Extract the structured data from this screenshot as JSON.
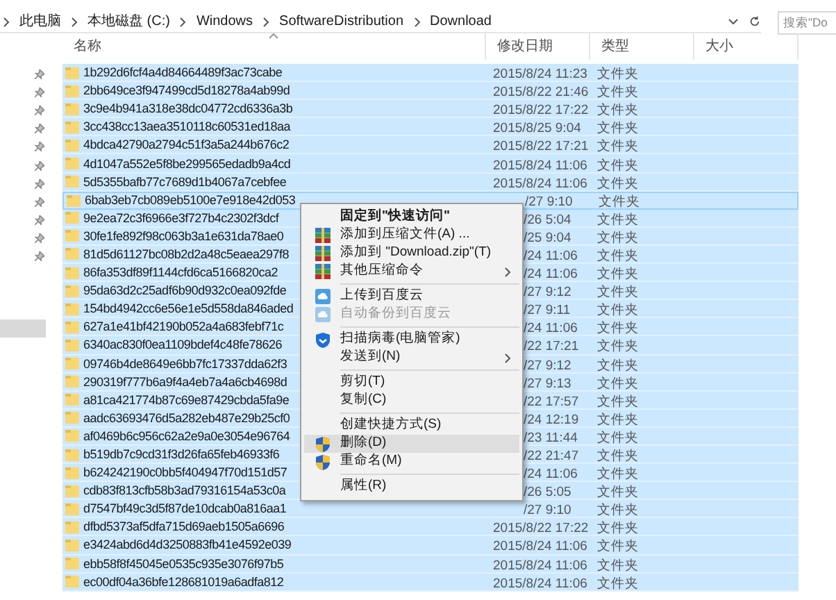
{
  "address_bar": {
    "crumbs": [
      "此电脑",
      "本地磁盘 (C:)",
      "Windows",
      "SoftwareDistribution",
      "Download"
    ]
  },
  "search": {
    "placeholder": "搜索\"Do"
  },
  "nav_items": [
    {
      "pinned": true,
      "selected": false
    },
    {
      "pinned": true,
      "selected": false
    },
    {
      "pinned": true,
      "selected": false
    },
    {
      "pinned": true,
      "selected": false
    },
    {
      "pinned": true,
      "selected": false
    },
    {
      "pinned": true,
      "selected": false
    },
    {
      "pinned": true,
      "selected": false
    },
    {
      "pinned": true,
      "selected": false
    },
    {
      "pinned": true,
      "selected": false
    },
    {
      "pinned": true,
      "selected": false
    },
    {
      "pinned": true,
      "selected": false
    },
    {
      "pinned": false,
      "selected": false
    },
    {
      "pinned": false,
      "selected": false
    },
    {
      "pinned": false,
      "selected": false
    },
    {
      "pinned": false,
      "selected": true
    }
  ],
  "columns": [
    {
      "label": "名称",
      "sorted": true
    },
    {
      "label": "修改日期",
      "sorted": false
    },
    {
      "label": "类型",
      "sorted": false
    },
    {
      "label": "大小",
      "sorted": false
    }
  ],
  "rows": [
    {
      "name": "1b292d6fcf4a4d84664489f3ac73cabe",
      "date": "2015/8/24 11:23",
      "type": "文件夹",
      "selected": true,
      "focused": false,
      "date_covered": false
    },
    {
      "name": "2bb649ce3f947499cd5d18278a4ab99d",
      "date": "2015/8/22 21:46",
      "type": "文件夹",
      "selected": true,
      "focused": false,
      "date_covered": false
    },
    {
      "name": "3c9e4b941a318e38dc04772cd6336a3b",
      "date": "2015/8/22 17:22",
      "type": "文件夹",
      "selected": true,
      "focused": false,
      "date_covered": false
    },
    {
      "name": "3cc438cc13aea3510118c60531ed18aa",
      "date": "2015/8/25 9:04",
      "type": "文件夹",
      "selected": true,
      "focused": false,
      "date_covered": false
    },
    {
      "name": "4bdca42790a2794c51f3a5a244b676c2",
      "date": "2015/8/22 17:21",
      "type": "文件夹",
      "selected": true,
      "focused": false,
      "date_covered": false
    },
    {
      "name": "4d1047a552e5f8be299565edadb9a4cd",
      "date": "2015/8/24 11:06",
      "type": "文件夹",
      "selected": true,
      "focused": false,
      "date_covered": false
    },
    {
      "name": "5d5355bafb77c7689d1b4067a7cebfee",
      "date": "2015/8/24 11:06",
      "type": "文件夹",
      "selected": true,
      "focused": false,
      "date_covered": false
    },
    {
      "name": "6bab3eb7cb089eb5100e7e918e42d053",
      "date": "/27 9:10",
      "type": "文件夹",
      "selected": true,
      "focused": true,
      "date_covered": true
    },
    {
      "name": "9e2ea72c3f6966e3f727b4c2302f3dcf",
      "date": "/26 5:04",
      "type": "文件夹",
      "selected": true,
      "focused": false,
      "date_covered": true
    },
    {
      "name": "30fe1fe892f98c063b3a1e631da78ae0",
      "date": "/25 9:04",
      "type": "文件夹",
      "selected": true,
      "focused": false,
      "date_covered": true
    },
    {
      "name": "81d5d61127bc08b2d2a48c5eaea297f8",
      "date": "/24 11:06",
      "type": "文件夹",
      "selected": true,
      "focused": false,
      "date_covered": true
    },
    {
      "name": "86fa353df89f1144cfd6ca5166820ca2",
      "date": "/24 11:06",
      "type": "文件夹",
      "selected": true,
      "focused": false,
      "date_covered": true
    },
    {
      "name": "95da63d2c25adf6b90d932c0ea092fde",
      "date": "/27 9:12",
      "type": "文件夹",
      "selected": true,
      "focused": false,
      "date_covered": true
    },
    {
      "name": "154bd4942cc6e56e1e5d558da846aded",
      "date": "/27 9:11",
      "type": "文件夹",
      "selected": true,
      "focused": false,
      "date_covered": true
    },
    {
      "name": "627a1e41bf42190b052a4a683febf71c",
      "date": "/24 11:06",
      "type": "文件夹",
      "selected": true,
      "focused": false,
      "date_covered": true
    },
    {
      "name": "6340ac830f0ea1109bdef4c48fe78626",
      "date": "/22 17:21",
      "type": "文件夹",
      "selected": true,
      "focused": false,
      "date_covered": true
    },
    {
      "name": "09746b4de8649e6bb7fc17337dda62f3",
      "date": "/27 9:12",
      "type": "文件夹",
      "selected": true,
      "focused": false,
      "date_covered": true
    },
    {
      "name": "290319f777b6a9f4a4eb7a4a6cb4698d",
      "date": "/27 9:13",
      "type": "文件夹",
      "selected": true,
      "focused": false,
      "date_covered": true
    },
    {
      "name": "a81ca421774b87c69e87429cbda5fa9e",
      "date": "/22 17:57",
      "type": "文件夹",
      "selected": true,
      "focused": false,
      "date_covered": true
    },
    {
      "name": "aadc63693476d5a282eb487e29b25cf0",
      "date": "/24 12:19",
      "type": "文件夹",
      "selected": true,
      "focused": false,
      "date_covered": true
    },
    {
      "name": "af0469b6c956c62a2e9a0e3054e96764",
      "date": "/23 11:44",
      "type": "文件夹",
      "selected": true,
      "focused": false,
      "date_covered": true
    },
    {
      "name": "b519db7c9cd31f3d26fa65feb46933f6",
      "date": "/22 21:47",
      "type": "文件夹",
      "selected": true,
      "focused": false,
      "date_covered": true
    },
    {
      "name": "b624242190c0bb5f404947f70d151d57",
      "date": "/24 11:06",
      "type": "文件夹",
      "selected": true,
      "focused": false,
      "date_covered": true
    },
    {
      "name": "cdb83f813cfb58b3ad79316154a53c0a",
      "date": "/26 5:05",
      "type": "文件夹",
      "selected": true,
      "focused": false,
      "date_covered": true
    },
    {
      "name": "d7547bf49c3d5f87de10dcab0a816aa1",
      "date": "/27 9:10",
      "type": "文件夹",
      "selected": true,
      "focused": false,
      "date_covered": true
    },
    {
      "name": "dfbd5373af5dfa715d69aeb1505a6696",
      "date": "2015/8/22 17:22",
      "type": "文件夹",
      "selected": true,
      "focused": false,
      "date_covered": false
    },
    {
      "name": "e3424abd6d4d3250883fb41e4592e039",
      "date": "2015/8/24 11:06",
      "type": "文件夹",
      "selected": true,
      "focused": false,
      "date_covered": false
    },
    {
      "name": "ebb58f8f45045e0535c935e3076f97b5",
      "date": "2015/8/24 11:06",
      "type": "文件夹",
      "selected": true,
      "focused": false,
      "date_covered": false
    },
    {
      "name": "ec00df04a36bfe128681019a6adfa812",
      "date": "2015/8/24 11:06",
      "type": "文件夹",
      "selected": true,
      "focused": false,
      "date_covered": false
    }
  ],
  "context_menu": [
    {
      "kind": "item",
      "label": "固定到\"快速访问\"",
      "bold": true,
      "disabled": false,
      "highlighted": false,
      "submenu": false
    },
    {
      "kind": "archive",
      "label": "添加到压缩文件(A) ...",
      "bold": false,
      "disabled": false,
      "highlighted": false,
      "submenu": false
    },
    {
      "kind": "archive",
      "label": "添加到 \"Download.zip\"(T)",
      "bold": false,
      "disabled": false,
      "highlighted": false,
      "submenu": false
    },
    {
      "kind": "archive",
      "label": "其他压缩命令",
      "bold": false,
      "disabled": false,
      "highlighted": false,
      "submenu": true
    },
    {
      "kind": "separator"
    },
    {
      "kind": "cloud",
      "label": "上传到百度云",
      "bold": false,
      "disabled": false,
      "highlighted": false,
      "submenu": false
    },
    {
      "kind": "cloud",
      "label": "自动备份到百度云",
      "bold": false,
      "disabled": true,
      "highlighted": false,
      "submenu": false
    },
    {
      "kind": "separator"
    },
    {
      "kind": "scan",
      "label": "扫描病毒(电脑管家)",
      "bold": false,
      "disabled": false,
      "highlighted": false,
      "submenu": false
    },
    {
      "kind": "item",
      "label": "发送到(N)",
      "bold": false,
      "disabled": false,
      "highlighted": false,
      "submenu": true
    },
    {
      "kind": "separator"
    },
    {
      "kind": "item",
      "label": "剪切(T)",
      "bold": false,
      "disabled": false,
      "highlighted": false,
      "submenu": false
    },
    {
      "kind": "item",
      "label": "复制(C)",
      "bold": false,
      "disabled": false,
      "highlighted": false,
      "submenu": false
    },
    {
      "kind": "separator"
    },
    {
      "kind": "item",
      "label": "创建快捷方式(S)",
      "bold": false,
      "disabled": false,
      "highlighted": false,
      "submenu": false
    },
    {
      "kind": "shield",
      "label": "删除(D)",
      "bold": false,
      "disabled": false,
      "highlighted": true,
      "submenu": false
    },
    {
      "kind": "shield",
      "label": "重命名(M)",
      "bold": false,
      "disabled": false,
      "highlighted": false,
      "submenu": false
    },
    {
      "kind": "separator"
    },
    {
      "kind": "item",
      "label": "属性(R)",
      "bold": false,
      "disabled": false,
      "highlighted": false,
      "submenu": false
    }
  ]
}
